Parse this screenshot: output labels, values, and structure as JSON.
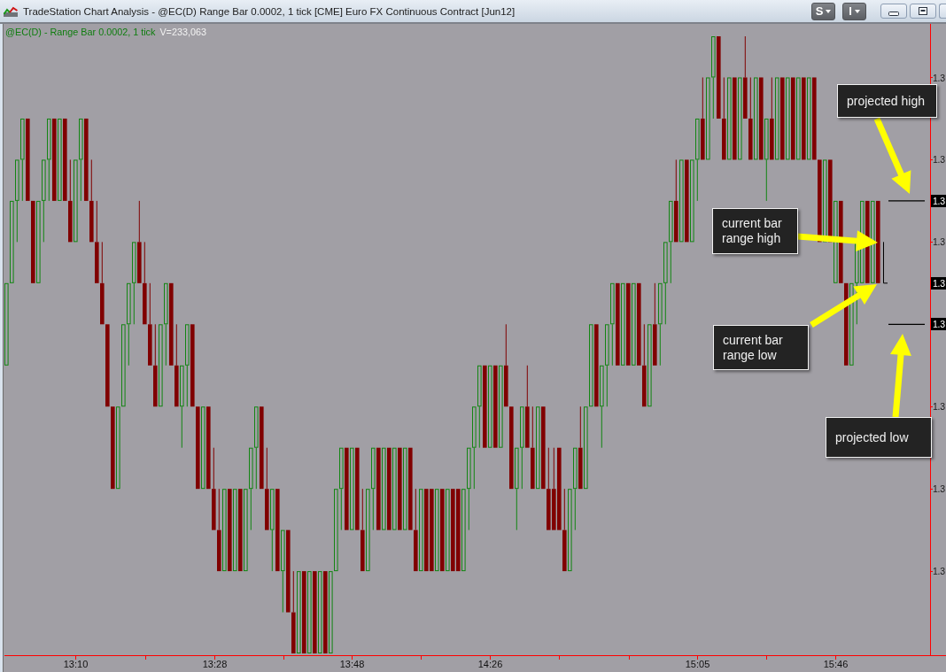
{
  "window": {
    "title": "TradeStation Chart Analysis - @EC(D) Range Bar 0.0002, 1 tick [CME] Euro FX Continuous Contract [Jun12]",
    "toolbar_buttons": [
      {
        "label": "S"
      },
      {
        "label": "I"
      }
    ]
  },
  "chart": {
    "legend": {
      "symbol": "@EC(D) - Range Bar 0.0002, 1 tick",
      "volume": "V=233,063"
    },
    "price_axis": [
      {
        "label": "1.3",
        "highlighted": false
      },
      {
        "label": "1.3",
        "highlighted": false
      },
      {
        "label": "1.3",
        "highlighted": true
      },
      {
        "label": "1.3",
        "highlighted": false
      },
      {
        "label": "1.3",
        "highlighted": true
      },
      {
        "label": "1.3",
        "highlighted": true
      },
      {
        "label": "1.3",
        "highlighted": false
      },
      {
        "label": "1.3",
        "highlighted": false
      },
      {
        "label": "1.3",
        "highlighted": false
      }
    ],
    "time_axis": [
      "13:10",
      "13:28",
      "13:48",
      "14:26",
      "15:05",
      "15:46"
    ],
    "annotations": [
      {
        "text": "projected high"
      },
      {
        "text": "current bar range high"
      },
      {
        "text": "current bar range low"
      },
      {
        "text": "projected low"
      }
    ]
  }
}
